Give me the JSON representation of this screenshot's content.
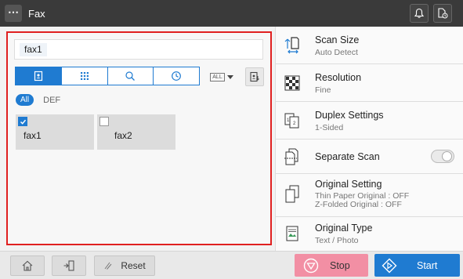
{
  "app": {
    "menu_icon": "more-icon",
    "title": "Fax",
    "notification_icon": "bell-icon",
    "status_icon": "device-status-icon"
  },
  "destination": {
    "chip": "fax1"
  },
  "search_tabs": [
    {
      "icon": "address-book-icon",
      "active": true
    },
    {
      "icon": "keypad-icon",
      "active": false
    },
    {
      "icon": "search-icon",
      "active": false
    },
    {
      "icon": "history-icon",
      "active": false
    }
  ],
  "filter_dropdown": {
    "label": "ALL",
    "icon": "chevron-down-icon"
  },
  "filters": {
    "all": "All",
    "def": "DEF"
  },
  "address_cards": [
    {
      "label": "fax1",
      "checked": true
    },
    {
      "label": "fax2",
      "checked": false
    }
  ],
  "settings": {
    "scan_size": {
      "title": "Scan Size",
      "value": "Auto Detect"
    },
    "resolution": {
      "title": "Resolution",
      "value": "Fine"
    },
    "duplex": {
      "title": "Duplex Settings",
      "value": "1-Sided"
    },
    "separate_scan": {
      "title": "Separate Scan",
      "enabled": false
    },
    "original_setting": {
      "title": "Original Setting",
      "value_line1": "Thin Paper Original : OFF",
      "value_line2": "Z-Folded Original : OFF"
    },
    "original_type": {
      "title": "Original Type",
      "value": "Text / Photo"
    }
  },
  "bottom": {
    "home_icon": "home-icon",
    "logout_icon": "logout-icon",
    "reset_label": "Reset",
    "stop_label": "Stop",
    "start_label": "Start"
  },
  "colors": {
    "accent": "#1f7bd1",
    "highlight_border": "#e02020",
    "stop": "#f28fa4",
    "top_bar": "#3a3a3a"
  }
}
